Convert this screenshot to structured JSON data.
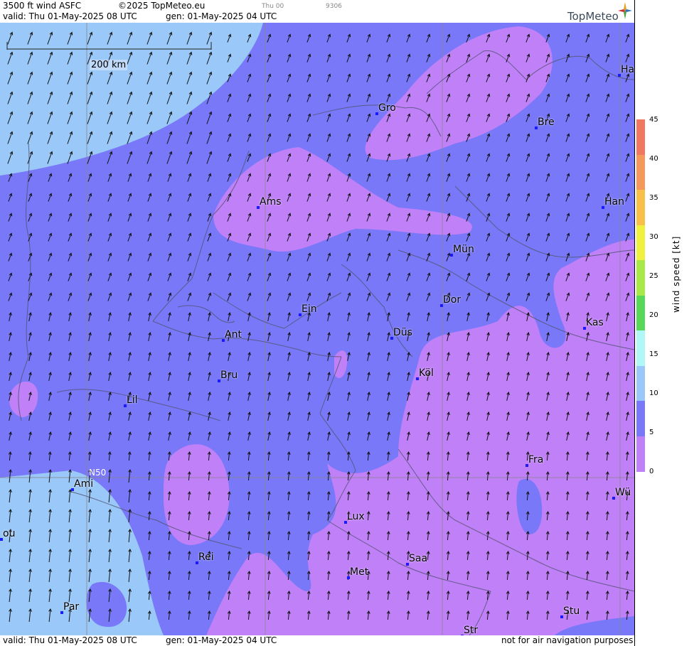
{
  "header": {
    "product": "3500 ft wind ASFC",
    "copyright": "©2025 TopMeteo.eu",
    "valid": "valid:  Thu  01-May-2025  08 UTC",
    "gen": "gen: 01-May-2025 04 UTC",
    "small_time": "Thu 00",
    "small_code": "9306",
    "logo": "TopMeteo"
  },
  "footer": {
    "valid": "valid:  Thu  01-May-2025  08 UTC",
    "gen": "gen: 01-May-2025 04 UTC",
    "disclaimer": "not for air navigation purposes"
  },
  "scale": {
    "label": "200 km"
  },
  "grid_label": "N50",
  "legend": {
    "title": "wind  speed  [kt]",
    "ticks": [
      "45",
      "40",
      "35",
      "30",
      "25",
      "20",
      "15",
      "10",
      "5",
      "0"
    ],
    "colors": [
      "#f07860",
      "#f4985c",
      "#f8c048",
      "#f0f040",
      "#a8e848",
      "#58d858",
      "#b0f8f8",
      "#9ac8f8",
      "#7878f8",
      "#c080f8"
    ]
  },
  "cities": [
    {
      "name": "Gro"
    },
    {
      "name": "Bre"
    },
    {
      "name": "Ha"
    },
    {
      "name": "Ams"
    },
    {
      "name": "Han"
    },
    {
      "name": "Mün"
    },
    {
      "name": "Dor"
    },
    {
      "name": "Ein"
    },
    {
      "name": "Ant"
    },
    {
      "name": "Düs"
    },
    {
      "name": "Kas"
    },
    {
      "name": "Bru"
    },
    {
      "name": "Köl"
    },
    {
      "name": "Lil"
    },
    {
      "name": "Fra"
    },
    {
      "name": "Ami"
    },
    {
      "name": "Wü"
    },
    {
      "name": "Lux"
    },
    {
      "name": "ou"
    },
    {
      "name": "Rei"
    },
    {
      "name": "Saa"
    },
    {
      "name": "Met"
    },
    {
      "name": "Stu"
    },
    {
      "name": "Par"
    },
    {
      "name": "Str"
    }
  ],
  "colors": {
    "calm": "#c080f8",
    "light": "#7878f8",
    "moderate": "#9ac8f8"
  }
}
